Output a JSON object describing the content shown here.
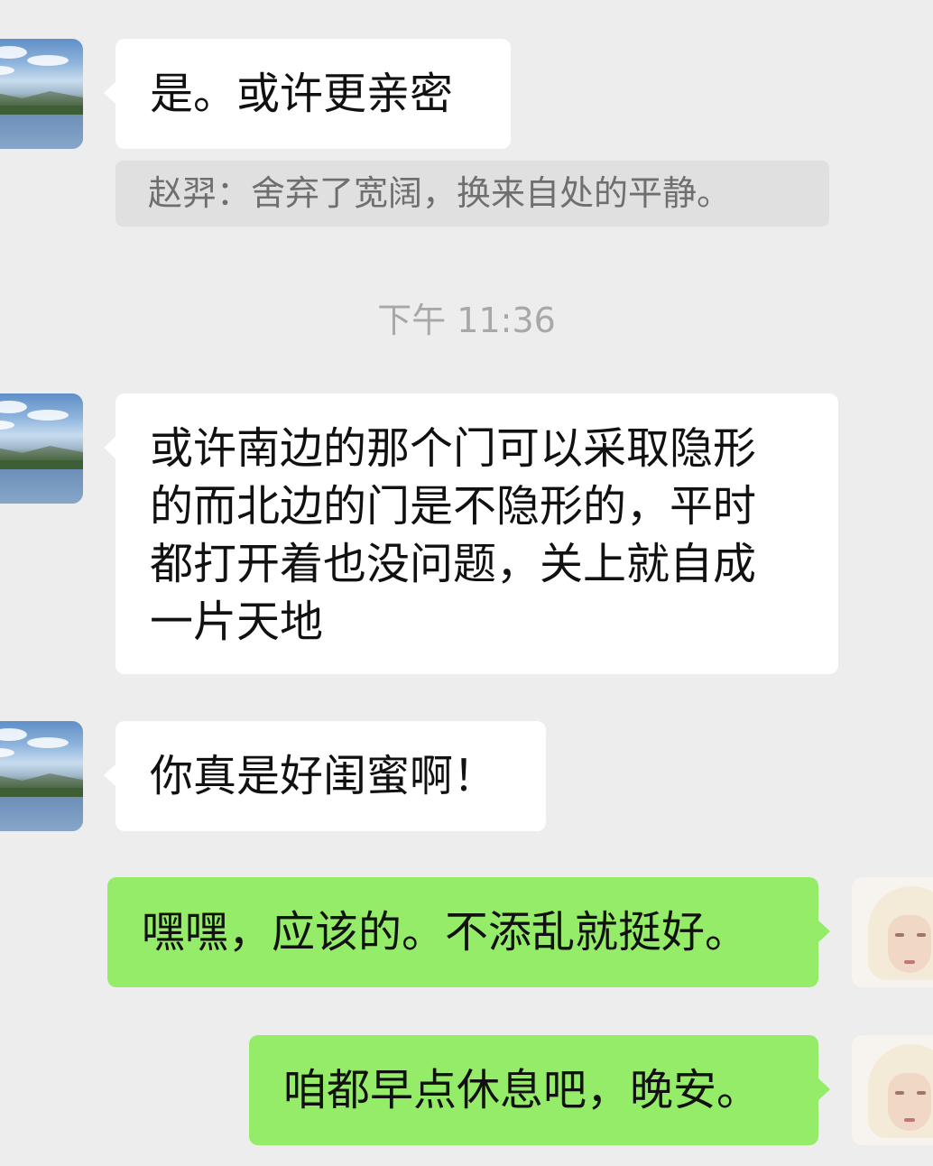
{
  "colors": {
    "background": "#ededed",
    "incoming_bubble": "#ffffff",
    "outgoing_bubble": "#95ec69",
    "quote_background": "#e0e0e0",
    "quote_text": "#6f6f6f",
    "timestamp_text": "#a8a8a8"
  },
  "messages": [
    {
      "direction": "incoming",
      "avatar": "landscape-avatar",
      "text": "是。或许更亲密"
    },
    {
      "direction": "quote",
      "text": "赵羿：舍弃了宽阔，换来自处的平静。"
    },
    {
      "direction": "timestamp",
      "text": "下午 11:36"
    },
    {
      "direction": "incoming",
      "avatar": "landscape-avatar",
      "text": "或许南边的那个门可以采取隐形\n的而北边的门是不隐形的，平时\n都打开着也没问题，关上就自成\n一片天地"
    },
    {
      "direction": "incoming",
      "avatar": "landscape-avatar",
      "text": "你真是好闺蜜啊！"
    },
    {
      "direction": "outgoing",
      "avatar": "portrait-avatar",
      "text": "嘿嘿，应该的。不添乱就挺好。"
    },
    {
      "direction": "outgoing",
      "avatar": "portrait-avatar",
      "text": "咱都早点休息吧，晚安。"
    }
  ]
}
